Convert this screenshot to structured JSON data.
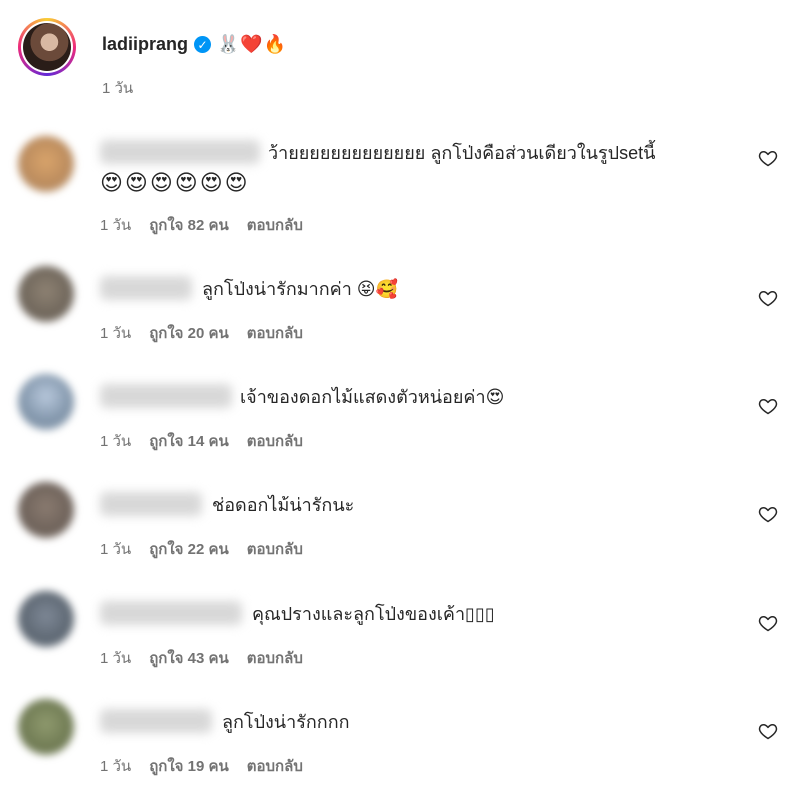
{
  "owner": {
    "username": "ladiiprang",
    "emoji": "🐰❤️🔥",
    "time": "1 วัน"
  },
  "reply_label": "ตอบกลับ",
  "comments": [
    {
      "text": "ว้ายยยยยยยยยยยยย ลูกโป่งคือส่วนเดียวในรูปsetนี้",
      "text2": "😍😍😍😍😍😍",
      "time": "1 วัน",
      "likes": "ถูกใจ 82 คน"
    },
    {
      "text": "ลูกโป่งน่ารักมากค่า 😝🥰",
      "time": "1 วัน",
      "likes": "ถูกใจ 20 คน"
    },
    {
      "text": "เจ้าของดอกไม้แสดงตัวหน่อยค่า😍",
      "time": "1 วัน",
      "likes": "ถูกใจ 14 คน"
    },
    {
      "text": "ช่อดอกไม้น่ารักนะ",
      "time": "1 วัน",
      "likes": "ถูกใจ 22 คน"
    },
    {
      "text": "คุณปรางและลูกโป่งของเค้า▯▯▯",
      "time": "1 วัน",
      "likes": "ถูกใจ 43 คน"
    },
    {
      "text": "ลูกโป่งน่ารักกกก",
      "time": "1 วัน",
      "likes": "ถูกใจ 19 คน"
    }
  ],
  "icons": {
    "heart": "heart-outline-icon",
    "verified": "verified-badge-icon"
  },
  "colors": {
    "verified": "#0095f6",
    "meta": "#737373",
    "text": "#262626"
  }
}
